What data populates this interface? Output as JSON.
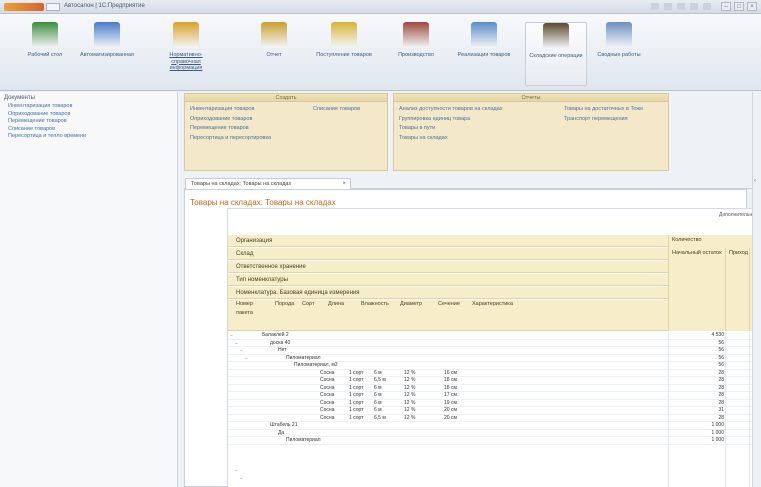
{
  "window": {
    "title": "Автосалон | 1С:Предприятие"
  },
  "ribbon": {
    "buttons": [
      {
        "id": "desktop",
        "label": "Рабочий стол",
        "color": "#3c8c3c"
      },
      {
        "id": "purchases",
        "label": "Автоматизированная",
        "color": "#4a78c8"
      },
      {
        "id": "ref",
        "label": "Нормативно-справочная информация",
        "color": "#d8a02a",
        "link": true
      },
      {
        "id": "sales",
        "label": "Отчет",
        "color": "#c8a030"
      },
      {
        "id": "receipts",
        "label": "Поступление товаров",
        "color": "#d6b23a"
      },
      {
        "id": "production",
        "label": "Производство",
        "color": "#9b4a3a"
      },
      {
        "id": "realization",
        "label": "Реализация товаров",
        "color": "#5a8acb"
      },
      {
        "id": "warehouse",
        "label": "Складские операции",
        "color": "#5b4a30",
        "active": true
      },
      {
        "id": "reports",
        "label": "Сводные работы",
        "color": "#6a8fbf"
      }
    ]
  },
  "sidebar": {
    "heading": "Документы",
    "items": [
      "Инвентаризация товаров",
      "Оприходование товаров",
      "Перемещение товаров",
      "Списание товаров",
      "Пересортица и тепло времени"
    ]
  },
  "panel_docs": {
    "title": "Создать",
    "col1": [
      "Инвентаризация товаров",
      "Оприходование товаров",
      "Перемещение товаров",
      "Пересортица и пересортировка"
    ],
    "col2": [
      "Списание товаров"
    ]
  },
  "panel_reports": {
    "title": "Отчеты",
    "col1": [
      "Анализ доступности товаров на складах",
      "Группировка единиц товара",
      "Товары в пути",
      "Товары на складах"
    ],
    "col2": [
      "Товары на достаточных в Тоже",
      "Транспорт перемещения"
    ]
  },
  "tab": {
    "label": "Товары на складах: Товары на складах",
    "close": "×"
  },
  "report": {
    "title": "Товары на складах: Товары на складах",
    "settings": "Дополнительно",
    "header_rows": [
      "Организация",
      "Склад",
      "Ответственное хранение",
      "Тип номенклатуры",
      "Номенклатура. Базовая единица измерения"
    ],
    "header_cols": [
      "Номер пакета",
      "Порода",
      "Сорт",
      "Длина",
      "Влажность",
      "Диаметр",
      "Сечение",
      "Характеристика"
    ],
    "qty_headers": {
      "main": "Количество",
      "start": "Начальный остаток",
      "in": "Приход",
      "out": "Рас"
    },
    "groups": [
      {
        "label": "Балаклей 2",
        "qty": "4 530",
        "indent": 2
      },
      {
        "label": "доска 40",
        "qty": "56",
        "indent": 6
      },
      {
        "label": "Нет",
        "qty": "56",
        "indent": 10
      },
      {
        "label": "Пиломатериал",
        "qty": "56",
        "indent": 14
      },
      {
        "label": "Пиломатериал, м3",
        "qty": "56",
        "indent": 18
      }
    ],
    "detail_rows": [
      {
        "c1": "Сосна",
        "c2": "1 сорт",
        "c3": "6 м",
        "c4": "12 %",
        "c5": "16 см",
        "qty": "28"
      },
      {
        "c1": "Сосна",
        "c2": "1 сорт",
        "c3": "6,5 м",
        "c4": "12 %",
        "c5": "18 см",
        "qty": "28"
      },
      {
        "c1": "Сосна",
        "c2": "1 сорт",
        "c3": "6 м",
        "c4": "12 %",
        "c5": "18 см",
        "qty": "28"
      },
      {
        "c1": "Сосна",
        "c2": "1 сорт",
        "c3": "6 м",
        "c4": "12 %",
        "c5": "17 см",
        "qty": "28"
      },
      {
        "c1": "Сосна",
        "c2": "1 сорт",
        "c3": "6 м",
        "c4": "12 %",
        "c5": "19 см",
        "qty": "28"
      },
      {
        "c1": "Сосна",
        "c2": "1 сорт",
        "c3": "6 м",
        "c4": "12 %",
        "c5": "20 см",
        "qty": "31"
      },
      {
        "c1": "Сосна",
        "c2": "1 сорт",
        "c3": "6,5 м",
        "c4": "12 %",
        "c5": "20 см",
        "qty": "28"
      }
    ],
    "tail_groups": [
      {
        "label": "Штабель 21",
        "qty": "1 000",
        "indent": 6
      },
      {
        "label": "Да",
        "qty": "1 000",
        "indent": 10
      },
      {
        "label": "Пиломатериал",
        "qty": "1 000",
        "indent": 14
      }
    ]
  }
}
